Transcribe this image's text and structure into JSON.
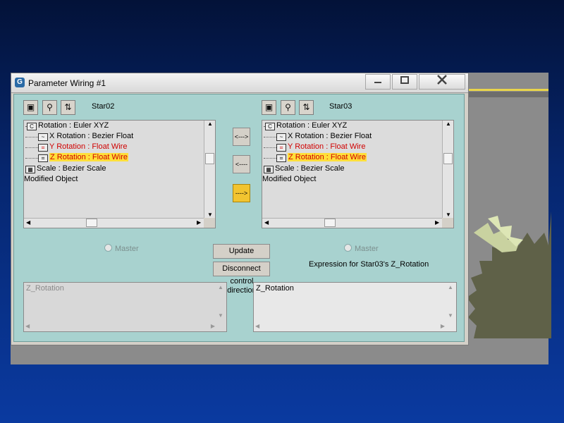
{
  "window": {
    "title": "Parameter Wiring #1",
    "app_icon": "3ds-max-icon",
    "controls": {
      "minimize": "minimize-icon",
      "maximize": "maximize-icon",
      "close": "close-icon"
    }
  },
  "left_panel": {
    "object_name": "Star02",
    "tree": [
      {
        "label": "Rotation : Euler XYZ",
        "style": "normal"
      },
      {
        "label": "X Rotation : Bezier Float",
        "style": "normal"
      },
      {
        "label": "Y Rotation : Float Wire",
        "style": "red"
      },
      {
        "label": "Z Rotation : Float Wire",
        "style": "highlight"
      },
      {
        "label": "Scale : Bezier Scale",
        "style": "normal"
      },
      {
        "label": "Modified Object",
        "style": "normal"
      }
    ],
    "master_label": "Master",
    "expression_text": "Z_Rotation"
  },
  "right_panel": {
    "object_name": "Star03",
    "tree": [
      {
        "label": "Rotation : Euler XYZ",
        "style": "normal"
      },
      {
        "label": "X Rotation : Bezier Float",
        "style": "normal"
      },
      {
        "label": "Y Rotation : Float Wire",
        "style": "red"
      },
      {
        "label": "Z Rotation : Float Wire",
        "style": "highlight"
      },
      {
        "label": "Scale : Bezier Scale",
        "style": "normal"
      },
      {
        "label": "Modified Object",
        "style": "normal"
      }
    ],
    "master_label": "Master",
    "expression_label": "Expression for Star03's Z_Rotation",
    "expression_text": "Z_Rotation"
  },
  "direction": {
    "both_label": "<--->",
    "left_label": "<----",
    "right_label": "---->",
    "active": "right",
    "control_label_1": "control",
    "control_label_2": "direction"
  },
  "buttons": {
    "update": "Update",
    "disconnect": "Disconnect"
  },
  "colors": {
    "panel": "#a8d2cf",
    "highlight": "#ffdf3a",
    "wire_text": "#d00000",
    "active_direction": "#f2c430"
  }
}
